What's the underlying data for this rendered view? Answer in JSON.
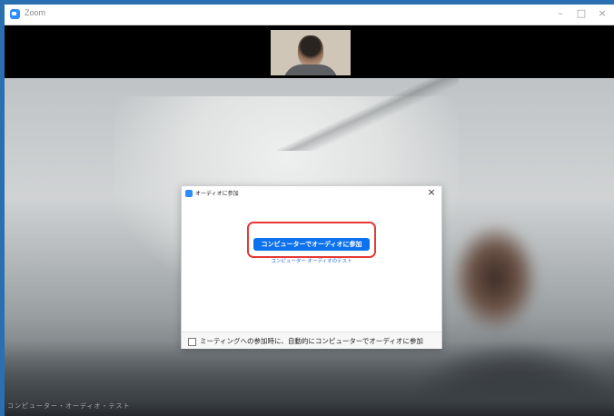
{
  "app": {
    "title": "Zoom",
    "minimize": "–",
    "maximize": "□",
    "close": "×"
  },
  "dialog": {
    "title": "オーディオに参加",
    "close": "×",
    "join_button": "コンピューターでオーディオに参加",
    "test_link": "コンピューター オーディオのテスト",
    "checkbox_label": "ミーティングへの参加時に、自動的にコンピューターでオーディオに参加",
    "checkbox_checked": false
  },
  "colors": {
    "accent": "#0e72ed",
    "highlight": "#e53935",
    "window_frame": "#1e6bb5"
  },
  "footer_overlay_text": "コンピューター・オーディオ・テスト"
}
